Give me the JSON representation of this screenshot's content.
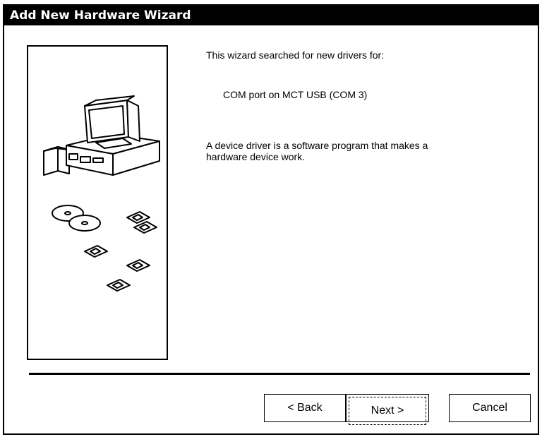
{
  "window": {
    "title": "Add New Hardware Wizard"
  },
  "content": {
    "search_text": "This wizard searched for new drivers for:",
    "device_name": "COM port on MCT USB (COM 3)",
    "driver_desc_line1": "A device driver is a software program that makes a",
    "driver_desc_line2": "hardware device work."
  },
  "buttons": {
    "back_label": "< Back",
    "next_label": "Next >",
    "cancel_label": "Cancel"
  },
  "icons": {
    "illustration": "computer-and-disks-illustration"
  }
}
